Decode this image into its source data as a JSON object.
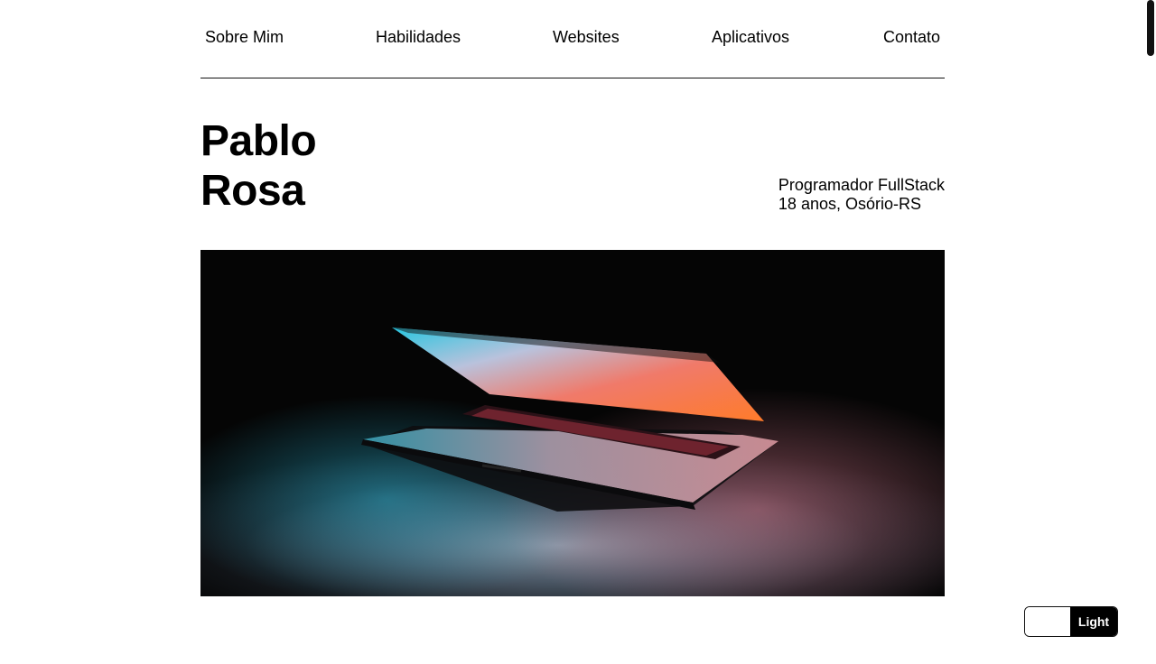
{
  "nav": {
    "items": [
      {
        "label": "Sobre Mim"
      },
      {
        "label": "Habilidades"
      },
      {
        "label": "Websites"
      },
      {
        "label": "Aplicativos"
      },
      {
        "label": "Contato"
      }
    ]
  },
  "hero": {
    "first_name": "Pablo",
    "last_name": "Rosa",
    "role": "Programador FullStack",
    "details": "18 anos, Osório-RS"
  },
  "photo": {
    "subject": "laptop-photo"
  },
  "theme_toggle": {
    "label": "Light"
  },
  "colors": {
    "text": "#000000",
    "background": "#ffffff",
    "toggle_active": "#000000"
  }
}
